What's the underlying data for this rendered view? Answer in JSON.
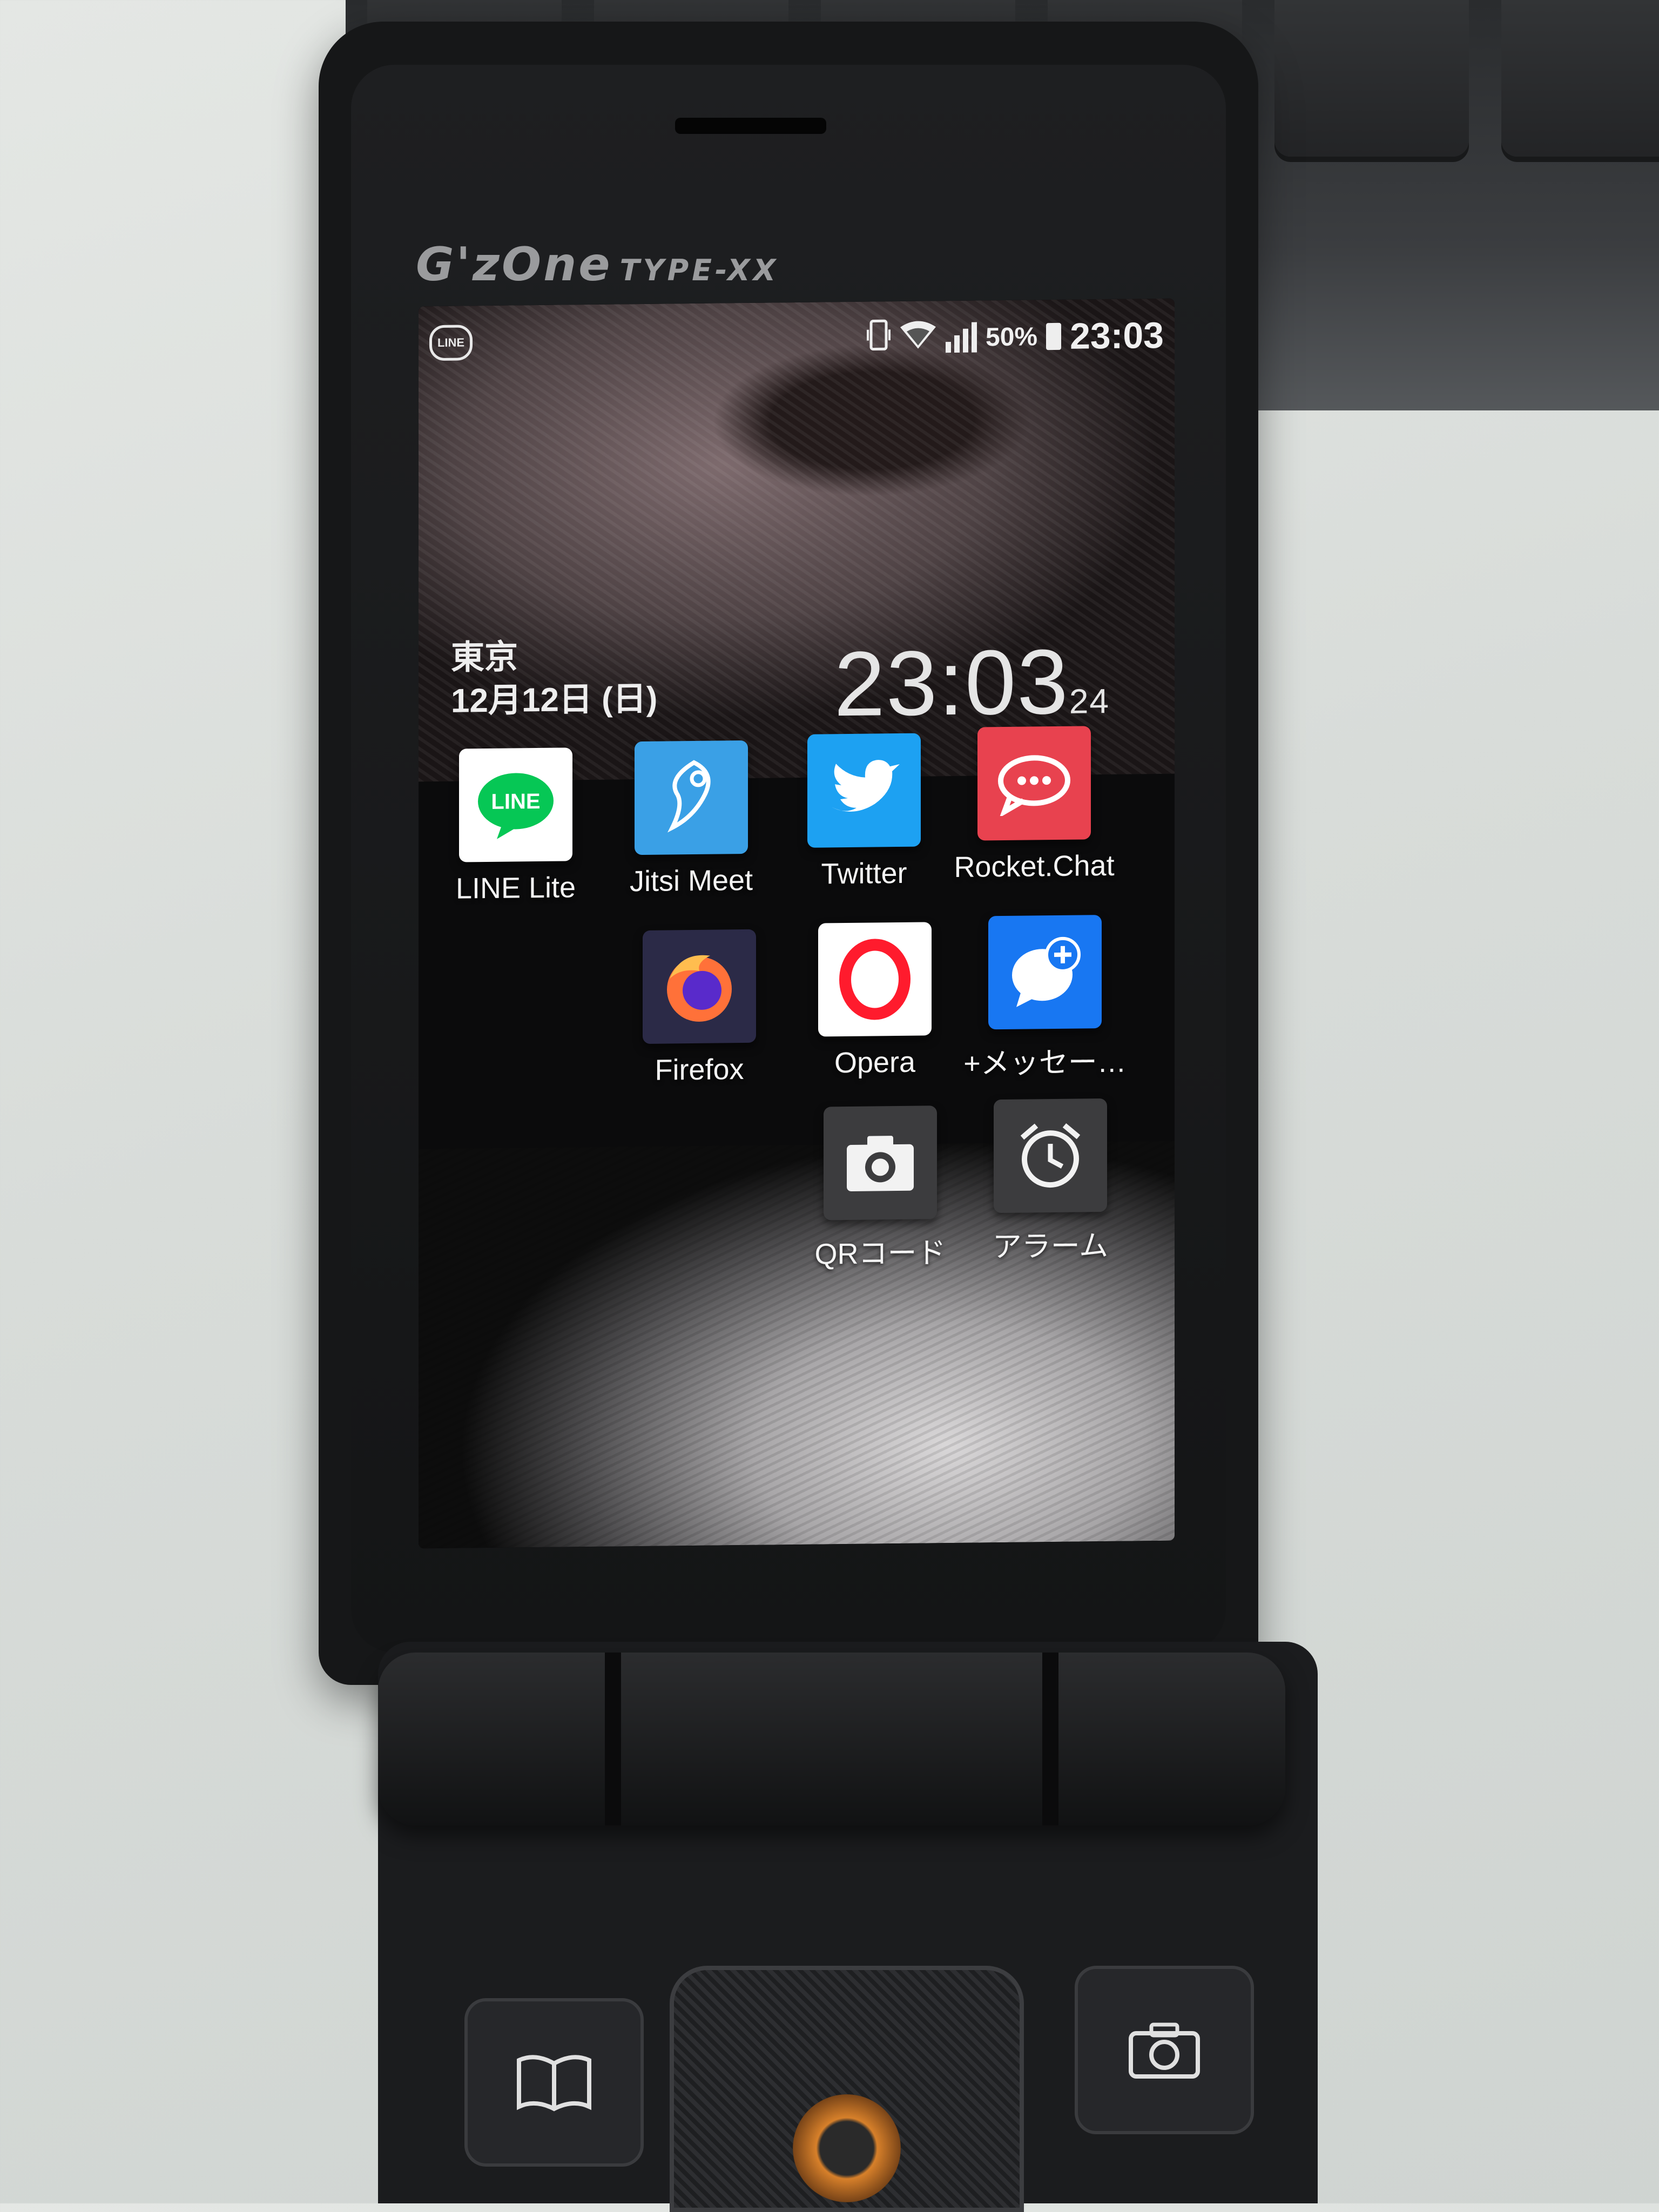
{
  "device": {
    "brand": "G'zOne",
    "model": "TYPE-XX"
  },
  "status_bar": {
    "notification_icon": "LINE",
    "battery": "50%",
    "time": "23:03"
  },
  "clock_widget": {
    "city": "東京",
    "date": "12月12日 (日)",
    "time": "23:03",
    "seconds": "24"
  },
  "apps": [
    {
      "label": "LINE Lite",
      "icon": "line-icon",
      "color": "#ffffff"
    },
    {
      "label": "Jitsi Meet",
      "icon": "jitsi-icon",
      "color": "#3aa0e6"
    },
    {
      "label": "Twitter",
      "icon": "twitter-bird-icon",
      "color": "#1da1f2"
    },
    {
      "label": "Rocket.Chat",
      "icon": "rocketchat-icon",
      "color": "#e8424f"
    },
    {
      "label": "Firefox",
      "icon": "firefox-icon",
      "color": "#2b2a47"
    },
    {
      "label": "Opera",
      "icon": "opera-icon",
      "color": "#ffffff"
    },
    {
      "label": "+メッセー…",
      "icon": "plus-message-icon",
      "color": "#1877f2"
    },
    {
      "label": "QRコード",
      "icon": "camera-icon",
      "color": "#3c3c3e"
    },
    {
      "label": "アラーム",
      "icon": "alarm-clock-icon",
      "color": "#3c3c3e"
    }
  ]
}
